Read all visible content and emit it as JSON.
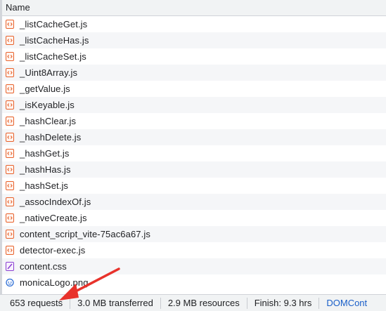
{
  "header": {
    "name_label": "Name"
  },
  "files": [
    {
      "name": "_listCacheGet.js",
      "icon": "js-file-icon"
    },
    {
      "name": "_listCacheHas.js",
      "icon": "js-file-icon"
    },
    {
      "name": "_listCacheSet.js",
      "icon": "js-file-icon"
    },
    {
      "name": "_Uint8Array.js",
      "icon": "js-file-icon"
    },
    {
      "name": "_getValue.js",
      "icon": "js-file-icon"
    },
    {
      "name": "_isKeyable.js",
      "icon": "js-file-icon"
    },
    {
      "name": "_hashClear.js",
      "icon": "js-file-icon"
    },
    {
      "name": "_hashDelete.js",
      "icon": "js-file-icon"
    },
    {
      "name": "_hashGet.js",
      "icon": "js-file-icon"
    },
    {
      "name": "_hashHas.js",
      "icon": "js-file-icon"
    },
    {
      "name": "_hashSet.js",
      "icon": "js-file-icon"
    },
    {
      "name": "_assocIndexOf.js",
      "icon": "js-file-icon"
    },
    {
      "name": "_nativeCreate.js",
      "icon": "js-file-icon"
    },
    {
      "name": "content_script_vite-75ac6a67.js",
      "icon": "js-file-icon"
    },
    {
      "name": "detector-exec.js",
      "icon": "js-file-icon"
    },
    {
      "name": "content.css",
      "icon": "css-file-icon"
    },
    {
      "name": "monicaLogo.png",
      "icon": "image-file-icon"
    }
  ],
  "status": {
    "requests": "653 requests",
    "transferred": "3.0 MB transferred",
    "resources": "2.9 MB resources",
    "finish": "Finish: 9.3 hrs",
    "domcontent": "DOMCont"
  },
  "colors": {
    "js_icon": "#e8622c",
    "css_icon": "#8a3fd1",
    "image_icon": "#2f6fd6",
    "annotation_arrow": "#e8322b"
  }
}
